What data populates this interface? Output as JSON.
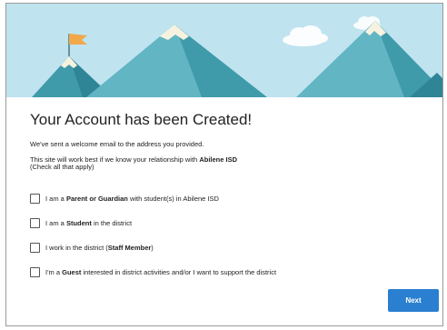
{
  "account_created": {
    "title": "Your Account has been Created!",
    "welcome_text": "We've sent a welcome email to the address you provided.",
    "relationship_prefix": "This site will work best if we know your relationship with ",
    "district_name": "Abilene ISD",
    "check_all_text": "(Check all that apply)"
  },
  "options": [
    {
      "prefix": "I am a ",
      "bold": "Parent or Guardian",
      "suffix": " with student(s) in Abilene ISD",
      "checked": false
    },
    {
      "prefix": "I am a ",
      "bold": "Student",
      "suffix": " in the district",
      "checked": false
    },
    {
      "prefix": "I work in the district (",
      "bold": "Staff Member",
      "suffix": ")",
      "checked": false
    },
    {
      "prefix": "I'm a ",
      "bold": "Guest",
      "suffix": " interested in district activities and/or I want to support the district",
      "checked": false
    }
  ],
  "actions": {
    "next_label": "Next"
  },
  "colors": {
    "sky": "#bfe3ef",
    "mountain_dark": "#3f9aaa",
    "mountain_light": "#62b5c3",
    "snow": "#f7f2df",
    "flag": "#f2a84a",
    "next_button": "#2a7fd0"
  }
}
